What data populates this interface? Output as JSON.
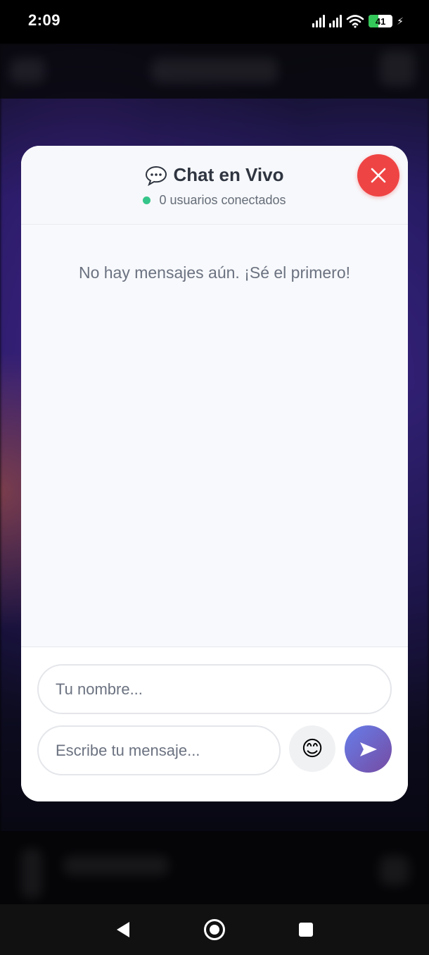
{
  "status_bar": {
    "time": "2:09",
    "battery_level": "41",
    "icons": [
      "signal-icon",
      "signal-icon",
      "wifi-icon",
      "battery-icon",
      "charging-bolt-icon"
    ]
  },
  "chat": {
    "title": "Chat en Vivo",
    "title_icon": "speech-bubble-icon",
    "online_text": "0 usuarios conectados",
    "empty_message": "No hay mensajes aún. ¡Sé el primero!",
    "name_placeholder": "Tu nombre...",
    "message_placeholder": "Escribe tu mensaje...",
    "emoji_glyph": "😊",
    "close_icon": "close-icon",
    "send_icon": "send-icon"
  },
  "colors": {
    "close_button": "#ef4444",
    "online_dot": "#35c58a",
    "send_gradient_start": "#667eea",
    "send_gradient_end": "#764ba2"
  },
  "nav_bar": {
    "buttons": [
      "back-icon",
      "home-icon",
      "recents-icon"
    ]
  }
}
